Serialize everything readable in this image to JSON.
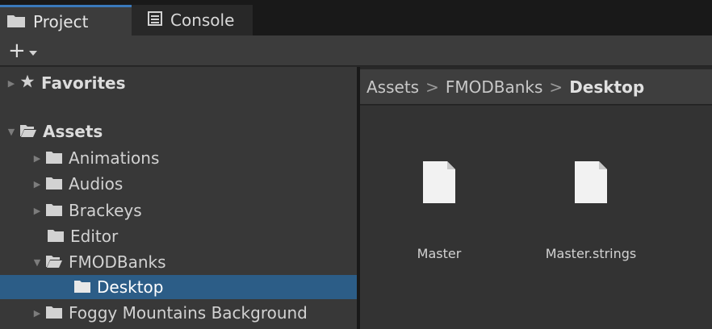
{
  "tabs": [
    {
      "label": "Project",
      "icon": "folder-icon",
      "active": true
    },
    {
      "label": "Console",
      "icon": "console-icon",
      "active": false
    }
  ],
  "toolbar": {
    "add_symbol": "+",
    "add_dropdown_icon": "caret-down-icon"
  },
  "tree": {
    "favorites": "Favorites",
    "assets": "Assets",
    "items": [
      {
        "label": "Animations"
      },
      {
        "label": "Audios"
      },
      {
        "label": "Brackeys"
      },
      {
        "label": "Editor"
      },
      {
        "label": "FMODBanks"
      },
      {
        "label": "Desktop"
      },
      {
        "label": "Foggy Mountains Background"
      }
    ]
  },
  "breadcrumb": {
    "items": [
      "Assets",
      "FMODBanks",
      "Desktop"
    ],
    "separator": ">"
  },
  "files": [
    {
      "name": "Master"
    },
    {
      "name": "Master.strings"
    }
  ],
  "colors": {
    "selection": "#2c5d87",
    "active_tab_accent": "#3a79bb",
    "panel": "#383838",
    "background": "#282828"
  }
}
